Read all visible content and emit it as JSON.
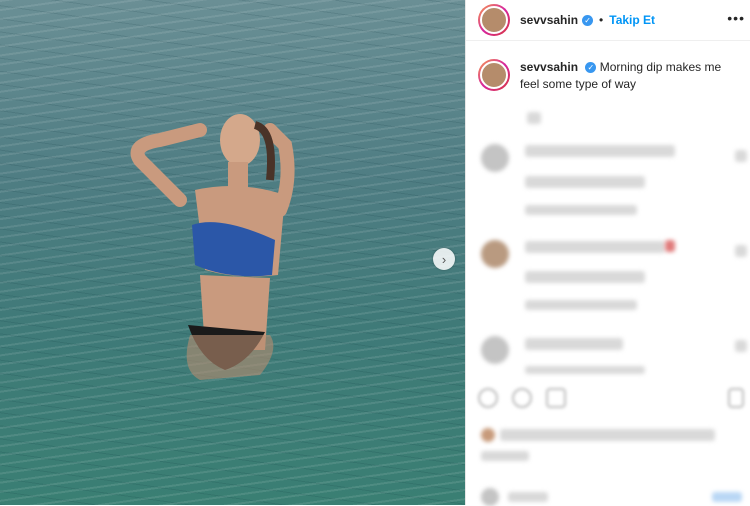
{
  "post": {
    "username": "sevvsahin",
    "follow_label": "Takip Et",
    "separator": "•",
    "more_label": "•••",
    "caption": "Morning dip makes me feel some type of way",
    "next_label": "›",
    "verified_mark": "✓"
  }
}
